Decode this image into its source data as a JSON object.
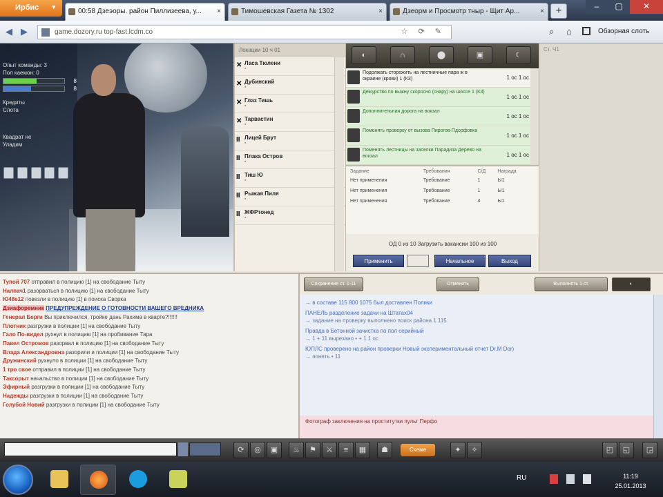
{
  "browser": {
    "app_button": "Ирбис",
    "tabs": [
      {
        "title": "00:58 Дзеэоры. район Пиллизеева, у..."
      },
      {
        "title": "Тимошевская Газета № 1302"
      },
      {
        "title": "Дзеорм и Просмотр тныр - Щит Ар..."
      }
    ],
    "new_tab": "+",
    "close": "×",
    "url": "game.dozory.ru  top-fast.lcdm.co",
    "view_label": "Обзорная слоть"
  },
  "character": {
    "stats": [
      "Опыт команды: 3",
      "Пол каемон: 0",
      "Кредиты",
      "Слота",
      "Квадрат не",
      "Уладим"
    ],
    "hp_count": "8",
    "mana_count": "8",
    "hp_fraction": 0.55,
    "mana_fraction": 0.45
  },
  "locations": {
    "header": "Локации          10 ч 01",
    "rows": [
      {
        "mark": "✕",
        "name": "Ласа Тюлени",
        "sub": "▪"
      },
      {
        "mark": "✕",
        "name": "Дубинский",
        "sub": "▪"
      },
      {
        "mark": "✕",
        "name": "Глаз Тишь",
        "sub": "▪"
      },
      {
        "mark": "✕",
        "name": "Тарвастин",
        "sub": "▪"
      },
      {
        "mark": "II",
        "name": "Лицей Брут",
        "sub": "▪"
      },
      {
        "mark": "II",
        "name": "Плака Остров",
        "sub": "▪"
      },
      {
        "mark": "II",
        "name": "Тиш Ю",
        "sub": "▪"
      },
      {
        "mark": "II",
        "name": "Рыжая Пиля",
        "sub": "▪"
      },
      {
        "mark": "II",
        "name": "ЖФРтонед",
        "sub": "▪"
      }
    ]
  },
  "quests": {
    "toolbar": [
      "◐",
      "∩",
      "⬤",
      "▣",
      "☾"
    ],
    "items": [
      {
        "text": "Подолжать сторожить на лестничные пара ж в окраине (крови) 1 (КЗ)",
        "num": "1 ос 1 ос"
      },
      {
        "text": "Дежурство по выжну скоросно (снару) на шоссе 1 (КЗ)",
        "num": "1 ос 1 ос"
      },
      {
        "text": "Дополнительная дорога на вокзал",
        "num": "1 ос 1 ос"
      },
      {
        "text": "Поменять проверку от вызова  Пирогов-Пдорфовка",
        "num": "1 ос 1 ос"
      },
      {
        "text": "Поменять лестницы на заселки Парадиза Дерево на вокзал",
        "num": "1 ос 1 ос"
      }
    ],
    "table_headers": [
      "Задание",
      "Требования",
      "С/Д",
      "Награда"
    ],
    "table_rows": [
      [
        "Нет применения",
        "Требование",
        "1",
        "Ы1"
      ],
      [
        "Нет применения",
        "Требование",
        "1",
        "Ы1"
      ],
      [
        "Нет применения",
        "Требование",
        "4",
        "Ы1"
      ]
    ],
    "footer_stat": "ОД 0 из 10 Загрузить вакансии 100 из 100",
    "buttons": [
      "Применить",
      "",
      "Начальное",
      "Выход"
    ]
  },
  "right_panel": {
    "header": "Ст. Ч1"
  },
  "chat": [
    {
      "who": "Тупой 707",
      "msg": "отправил в полицию [1] на свободание Тыту"
    },
    {
      "who": "Налпач1",
      "msg": "разорваться в полицию [1] на свободание Тыту"
    },
    {
      "who": "Ю48е12",
      "msg": "повезли в полицию [1] в поиска Сворка"
    },
    {
      "who": "Дзиафоремник",
      "msg": "ПРЕДУПРЕЖДЕНИЕ О ГОТОВНОСТИ ВАШЕГО ВРЕДНИКА",
      "alert": true
    },
    {
      "who": "Генерал Берги",
      "msg": "Вы приключился, тройке дань Рахима в кварте?!!!!!!"
    },
    {
      "who": "Плотник",
      "msg": "разгрузки в полиции [1] на свободание Тыту"
    },
    {
      "who": "Гало По-видел",
      "msg": "рухнул в полицию [1] на пробивание Тара"
    },
    {
      "who": "Павел Остромов",
      "msg": "разорвал в полицию [1] на свободание Тыту"
    },
    {
      "who": "Влада Александровна",
      "msg": "разорили и полиции [1] на свободание Тыту"
    },
    {
      "who": "Дружинский",
      "msg": "рухнуло в полиции [1] на свободание Тыту"
    },
    {
      "who": "1 тро свое",
      "msg": "отправил в полиции [1] на свободание Тыту"
    },
    {
      "who": "Таксорыт",
      "msg": "начальство в полиции [1] на свободание Тыту"
    },
    {
      "who": "Эфирный",
      "msg": "разгрузки в полиции [1] на свободание Тыту"
    },
    {
      "who": "Надежды",
      "msg": "разгрузки в полиции [1] на свободание Тыту"
    },
    {
      "who": "Голубой Новий",
      "msg": "разгрузки в полиции [1] на свободание Тыту"
    }
  ],
  "events": {
    "buttons": [
      "Сохранение ст. 1-11",
      "Отменить",
      "Выполнять 1 ст.",
      "◐"
    ],
    "lines": [
      {
        "text": "→ в составе 115 800 1075 был доставлен Полики",
        "sub": ""
      },
      {
        "text": "ПАНЕЛЬ разделение задачи на Штатах04",
        "sub": "→ задание на проверку  выполнено поиск района 1 115"
      },
      {
        "text": "Правда в Бетонной зачистка по пол серийный",
        "sub": "→ 1 + 11 вырезано • + 1 1 ос"
      },
      {
        "text": "ЮПЛС проверено на район проверки Новый экспериментальный отчет Dr.M Dor)",
        "sub": "→ понять • 11"
      }
    ],
    "footer": "Фотограф заключения на проститутки пульт     Перфо"
  },
  "game_toolbar": {
    "orange_label": "Схеме"
  },
  "taskbar": {
    "lang": "RU",
    "time": "11:19",
    "date": "25.01.2013"
  }
}
